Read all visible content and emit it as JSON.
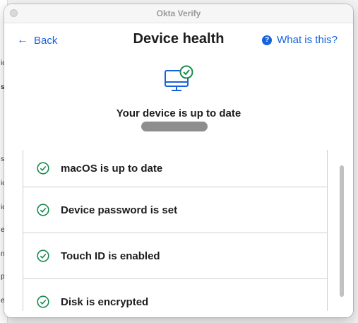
{
  "background": {
    "sidebar_fragments": [
      "ic",
      "s",
      "s",
      "ic",
      "ic",
      "e",
      "n",
      "p",
      "e"
    ]
  },
  "window": {
    "title": "Okta Verify"
  },
  "header": {
    "back_label": "Back",
    "title": "Device health",
    "help_label": "What is this?"
  },
  "status": {
    "icon": "monitor-check-icon",
    "text": "Your device is up to date",
    "device_name_redacted": true
  },
  "checks": [
    {
      "label": "macOS is up to date",
      "icon": "check-circle-icon"
    },
    {
      "label": "Device password is set",
      "icon": "check-circle-icon"
    },
    {
      "label": "Touch ID is enabled",
      "icon": "check-circle-icon"
    },
    {
      "label": "Disk is encrypted",
      "icon": "check-circle-icon"
    }
  ],
  "colors": {
    "accent": "#1662dd",
    "success": "#1a8a4f"
  }
}
